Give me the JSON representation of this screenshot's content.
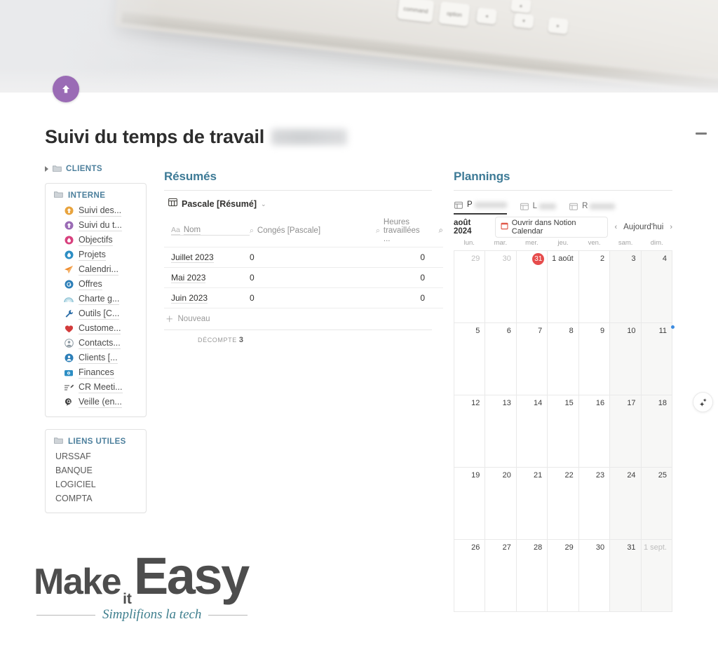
{
  "banner": {
    "keys": [
      "command",
      "option"
    ],
    "page_icon": "up-arrow-circle-icon",
    "page_icon_color": "#9a6bb5"
  },
  "header": {
    "title": "Suivi du temps de travail",
    "title_redacted": true,
    "collapse_icon": "minus-icon"
  },
  "sidebar": {
    "clients_group": {
      "label": "CLIENTS",
      "caret": "caret-right-icon",
      "folder_icon": "folder-icon"
    },
    "interne": {
      "label": "INTERNE",
      "folder_icon": "folder-icon",
      "items": [
        {
          "label": "Suivi des...",
          "icon": "up-arrow-circle-orange-icon",
          "color": "#e8a33d"
        },
        {
          "label": "Suivi du t...",
          "icon": "up-arrow-circle-purple-icon",
          "color": "#9a6bb5"
        },
        {
          "label": "Objectifs",
          "icon": "droplet-pink-icon",
          "color": "#d8417e"
        },
        {
          "label": "Projets",
          "icon": "droplet-blue-icon",
          "color": "#2d8ec4"
        },
        {
          "label": "Calendri...",
          "icon": "paper-plane-orange-icon",
          "color": "#ef8b2c"
        },
        {
          "label": "Offres",
          "icon": "spiral-blue-icon",
          "color": "#2d7fb8"
        },
        {
          "label": "Charte g...",
          "icon": "rainbow-icon",
          "color": "#7fb8cc"
        },
        {
          "label": "Outils [C...",
          "icon": "wrench-blue-icon",
          "color": "#2d6ea8"
        },
        {
          "label": "Custome...",
          "icon": "heart-red-icon",
          "color": "#d23b3b"
        },
        {
          "label": "Contacts...",
          "icon": "person-circle-gray-icon",
          "color": "#8d9aa3"
        },
        {
          "label": "Clients [...",
          "icon": "person-circle-blue-icon",
          "color": "#2d7fb8"
        },
        {
          "label": "Finances",
          "icon": "tv-blue-icon",
          "color": "#2d8ec4"
        },
        {
          "label": "CR Meeti...",
          "icon": "list-pen-icon",
          "color": "#4c4c4c"
        },
        {
          "label": "Veille (en...",
          "icon": "search-chat-icon",
          "color": "#3c3c3c"
        }
      ]
    },
    "liens_utiles": {
      "label": "LIENS UTILES",
      "folder_icon": "folder-icon",
      "items": [
        "URSSAF",
        "BANQUE",
        "LOGICIEL",
        "COMPTA"
      ]
    }
  },
  "resumes": {
    "section_title": "Résumés",
    "database_title": "Pascale [Résumé]",
    "database_icon": "table-icon",
    "chevron": "chevron-down-icon",
    "columns": [
      {
        "label": "Nom",
        "type_icon": "Aa"
      },
      {
        "label": "Congés [Pascale]",
        "type_icon": "search-icon"
      },
      {
        "label": "Heures travaillées ...",
        "type_icon": "search-icon"
      },
      {
        "label": "",
        "type_icon": "search-icon"
      }
    ],
    "rows": [
      {
        "nom": "Juillet 2023",
        "conges": "0",
        "heures": "0"
      },
      {
        "nom": "Mai 2023",
        "conges": "0",
        "heures": "0"
      },
      {
        "nom": "Juin 2023",
        "conges": "0",
        "heures": "0"
      }
    ],
    "new_row_label": "Nouveau",
    "count_label": "DÉCOMPTE",
    "count_value": "3"
  },
  "plannings": {
    "section_title": "Plannings",
    "tabs": [
      {
        "label": "P",
        "redacted": true,
        "redact_width": 46,
        "icon": "calendar-icon",
        "active": true
      },
      {
        "label": "L",
        "redacted": true,
        "redact_width": 24,
        "icon": "calendar-icon",
        "active": false
      },
      {
        "label": "R",
        "redacted": true,
        "redact_width": 36,
        "icon": "calendar-icon",
        "active": false
      }
    ],
    "toolbar": {
      "month": "août 2024",
      "open_button": "Ouvrir dans Notion Calendar",
      "open_button_icon": "calendar-red-icon",
      "prev_icon": "chevron-left-icon",
      "today_label": "Aujourd'hui",
      "next_icon": "chevron-right-icon"
    },
    "weekdays": [
      "lun.",
      "mar.",
      "mer.",
      "jeu.",
      "ven.",
      "sam.",
      "dim."
    ],
    "weeks": [
      [
        {
          "d": "29",
          "out": true
        },
        {
          "d": "30",
          "out": true
        },
        {
          "d": "31",
          "out": true,
          "today": true
        },
        {
          "d": "1 août"
        },
        {
          "d": "2"
        },
        {
          "d": "3",
          "weekend": true
        },
        {
          "d": "4",
          "weekend": true
        }
      ],
      [
        {
          "d": "5"
        },
        {
          "d": "6"
        },
        {
          "d": "7"
        },
        {
          "d": "8"
        },
        {
          "d": "9"
        },
        {
          "d": "10",
          "weekend": true
        },
        {
          "d": "11",
          "weekend": true,
          "dot": true
        }
      ],
      [
        {
          "d": "12"
        },
        {
          "d": "13"
        },
        {
          "d": "14"
        },
        {
          "d": "15"
        },
        {
          "d": "16"
        },
        {
          "d": "17",
          "weekend": true
        },
        {
          "d": "18",
          "weekend": true
        }
      ],
      [
        {
          "d": "19"
        },
        {
          "d": "20"
        },
        {
          "d": "21"
        },
        {
          "d": "22"
        },
        {
          "d": "23"
        },
        {
          "d": "24",
          "weekend": true
        },
        {
          "d": "25",
          "weekend": true
        }
      ],
      [
        {
          "d": "26"
        },
        {
          "d": "27"
        },
        {
          "d": "28"
        },
        {
          "d": "29"
        },
        {
          "d": "30"
        },
        {
          "d": "31",
          "weekend": true
        },
        {
          "d": "1 sept.",
          "weekend": true,
          "out": true
        }
      ]
    ]
  },
  "ai_button": {
    "icon": "sparkle-icon"
  },
  "logo": {
    "word1": "Make",
    "word2": "it",
    "word3": "Easy",
    "tagline": "Simplifions la tech"
  }
}
